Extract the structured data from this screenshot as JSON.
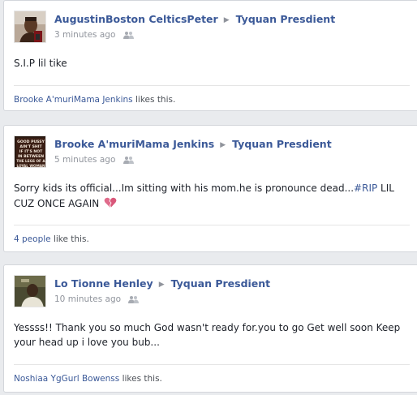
{
  "posts": [
    {
      "author": "AugustinBoston CelticsPeter",
      "target": "Tyquan Presdient",
      "time": "3 minutes ago",
      "body": "S.I.P lil tike",
      "likes_name": "Brooke A'muriMama Jenkins",
      "likes_suffix": " likes this."
    },
    {
      "author": "Brooke A'muriMama Jenkins",
      "target": "Tyquan Presdient",
      "time": "5 minutes ago",
      "avatar_text": [
        "GOOD PUSSY",
        "AIN'T SHIT",
        "IF IT'S NOT",
        "IN BETWEEN",
        "THE LEGS OF A",
        "LOYAL WOMAN"
      ],
      "body_pre": "Sorry kids its official...Im sitting with his mom.he is pronounce dead...",
      "body_hashtag": "#RIP",
      "body_post": " LIL CUZ ONCE AGAIN",
      "likes_name": "4 people",
      "likes_suffix": " like this."
    },
    {
      "author": "Lo Tionne Henley",
      "target": "Tyquan Presdient",
      "time": "10 minutes ago",
      "body": "Yessss!! Thank you so much God wasn't ready for.you to go Get well soon Keep your head up i love you bub...",
      "likes_name": "Noshiaa YgGurl Bowenss",
      "likes_suffix": " likes this."
    }
  ],
  "icons": {
    "arrow": "right-triangle-icon",
    "audience": "friends-icon",
    "broken_heart": "broken-heart-icon"
  },
  "colors": {
    "link": "#3b5998",
    "meta": "#90949c",
    "background": "#e9ebee",
    "heart": "#e06b8b"
  }
}
